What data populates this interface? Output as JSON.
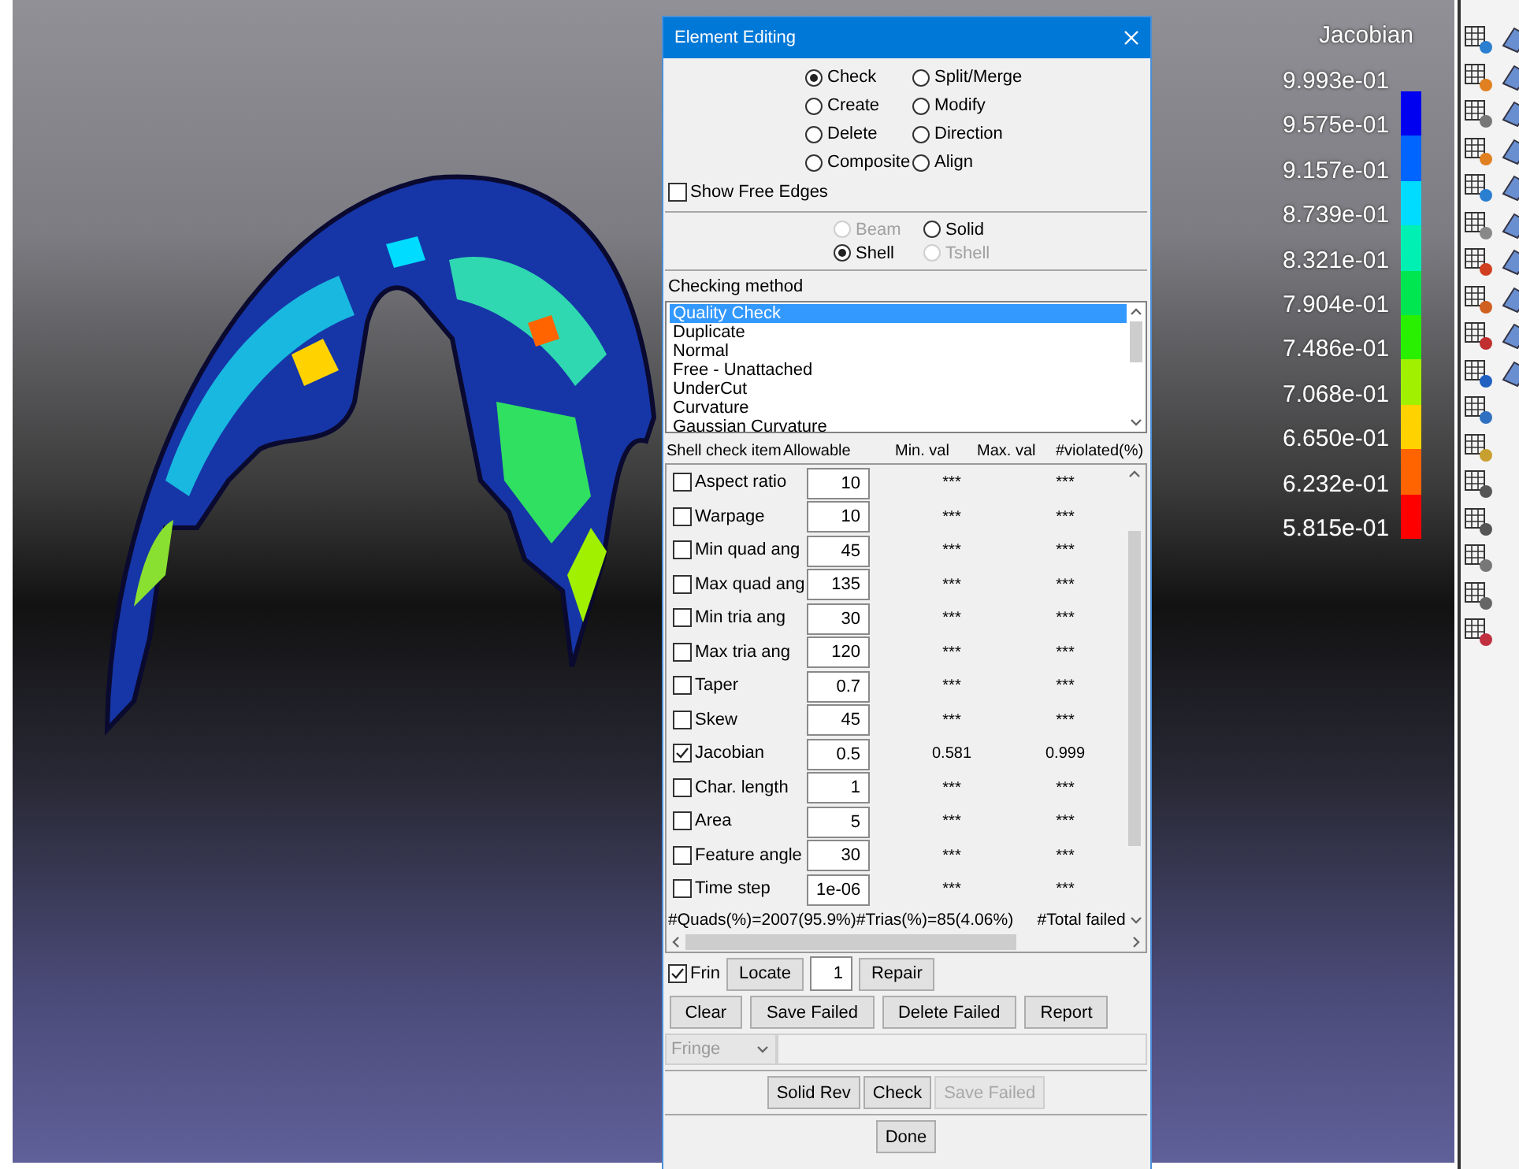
{
  "window": {
    "title": "Element Editing"
  },
  "modes": [
    {
      "label": "Check",
      "selected": true
    },
    {
      "label": "Split/Merge",
      "selected": false
    },
    {
      "label": "Create",
      "selected": false
    },
    {
      "label": "Modify",
      "selected": false
    },
    {
      "label": "Delete",
      "selected": false
    },
    {
      "label": "Direction",
      "selected": false
    },
    {
      "label": "Composite",
      "selected": false
    },
    {
      "label": "Align",
      "selected": false
    }
  ],
  "show_free_edges": {
    "label": "Show Free Edges",
    "checked": false
  },
  "element_types": [
    {
      "label": "Beam",
      "selected": false,
      "disabled": true
    },
    {
      "label": "Solid",
      "selected": false,
      "disabled": false
    },
    {
      "label": "Shell",
      "selected": true,
      "disabled": false
    },
    {
      "label": "Tshell",
      "selected": false,
      "disabled": true
    }
  ],
  "checking_method": {
    "label": "Checking method",
    "items": [
      {
        "label": "Quality Check",
        "selected": true
      },
      {
        "label": "Duplicate",
        "selected": false
      },
      {
        "label": "Normal",
        "selected": false
      },
      {
        "label": "Free - Unattached",
        "selected": false
      },
      {
        "label": "UnderCut",
        "selected": false
      },
      {
        "label": "Curvature",
        "selected": false
      },
      {
        "label": "Gaussian Curvature",
        "selected": false
      }
    ]
  },
  "check_table": {
    "columns": [
      "Shell check item",
      "Allowable",
      "Min. val",
      "Max. val",
      "#violated(%)"
    ],
    "rows": [
      {
        "name": "Aspect ratio",
        "checked": false,
        "allowable": "10",
        "min": "***",
        "max": "***"
      },
      {
        "name": "Warpage",
        "checked": false,
        "allowable": "10",
        "min": "***",
        "max": "***"
      },
      {
        "name": "Min quad ang",
        "checked": false,
        "allowable": "45",
        "min": "***",
        "max": "***"
      },
      {
        "name": "Max quad ang",
        "checked": false,
        "allowable": "135",
        "min": "***",
        "max": "***"
      },
      {
        "name": "Min tria ang",
        "checked": false,
        "allowable": "30",
        "min": "***",
        "max": "***"
      },
      {
        "name": "Max tria ang",
        "checked": false,
        "allowable": "120",
        "min": "***",
        "max": "***"
      },
      {
        "name": "Taper",
        "checked": false,
        "allowable": "0.7",
        "min": "***",
        "max": "***"
      },
      {
        "name": "Skew",
        "checked": false,
        "allowable": "45",
        "min": "***",
        "max": "***"
      },
      {
        "name": "Jacobian",
        "checked": true,
        "allowable": "0.5",
        "min": "0.581",
        "max": "0.999"
      },
      {
        "name": "Char. length",
        "checked": false,
        "allowable": "1",
        "min": "***",
        "max": "***"
      },
      {
        "name": "Area",
        "checked": false,
        "allowable": "5",
        "min": "***",
        "max": "***"
      },
      {
        "name": "Feature angle",
        "checked": false,
        "allowable": "30",
        "min": "***",
        "max": "***"
      },
      {
        "name": "Time step",
        "checked": false,
        "allowable": "1e-06",
        "min": "***",
        "max": "***"
      }
    ],
    "summary": [
      "#Quads(%)=2007(95.9%)",
      "#Trias(%)=85(4.06%)",
      "#Total failed"
    ]
  },
  "fringe": {
    "label": "Frin",
    "checked": true
  },
  "locate_button": "Locate",
  "index_field": "1",
  "repair_button": "Repair",
  "action_buttons": [
    "Clear",
    "Save Failed",
    "Delete Failed",
    "Report"
  ],
  "fringe_select": {
    "value": "Fringe",
    "disabled": true
  },
  "bottom_buttons": [
    {
      "label": "Solid Rev",
      "disabled": false
    },
    {
      "label": "Check",
      "disabled": false
    },
    {
      "label": "Save Failed",
      "disabled": true
    }
  ],
  "done_button": "Done",
  "legend": {
    "title": "Jacobian",
    "ticks": [
      "9.993e-01",
      "9.575e-01",
      "9.157e-01",
      "8.739e-01",
      "8.321e-01",
      "7.904e-01",
      "7.486e-01",
      "7.068e-01",
      "6.650e-01",
      "6.232e-01",
      "5.815e-01"
    ],
    "bands": [
      {
        "color": "#0000f0"
      },
      {
        "color": "#0064ff"
      },
      {
        "color": "#00dcff"
      },
      {
        "color": "#00f0b4"
      },
      {
        "color": "#00e650"
      },
      {
        "color": "#28f000"
      },
      {
        "color": "#a0f000"
      },
      {
        "color": "#ffd200"
      },
      {
        "color": "#ff6400"
      },
      {
        "color": "#ff0000"
      }
    ]
  }
}
